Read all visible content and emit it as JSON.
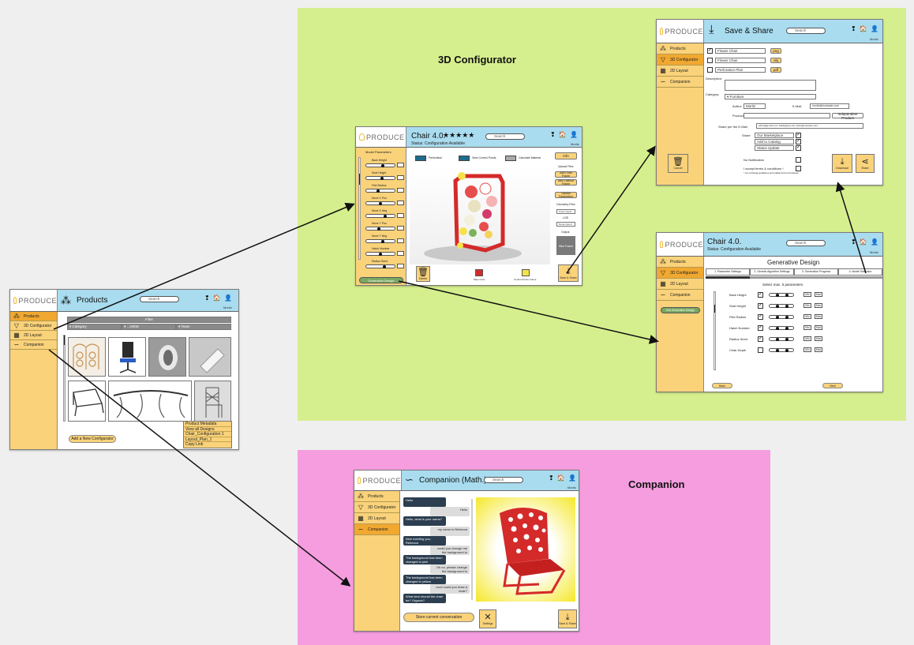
{
  "regions": {
    "configurator_label": "3D Configurator",
    "companion_label": "Companion"
  },
  "logo_text": "PRODUCE",
  "search_placeholder": "Search",
  "user_label": "Moritz",
  "header_icons": "❢ 🏠 👤",
  "sidebar": {
    "products": "Products",
    "configurator": "3D Configurator",
    "layout": "2D Layout",
    "companion": "Companion"
  },
  "products_screen": {
    "title": "Products",
    "filter_label": "Filter",
    "filter_cols": [
      "▾  Category",
      "▾  ...VIEW",
      "▾  Team"
    ],
    "context_menu": [
      "Product Metadata",
      "View all Designs",
      "Chair_Configuration 1",
      "Layout_Plan_1",
      "Copy Link"
    ],
    "add_button": "Add a New Configurator",
    "thumbnails": 8
  },
  "configurator_screen": {
    "title": "Chair 4.0.",
    "stars": "★★★★★",
    "subtitle": "Status: Configuration Available",
    "left_panel_title": "Model Parameters",
    "parameters": [
      "Back Height",
      "Seat Height",
      "Filet Radius",
      "Move X Pos",
      "Move X Neg",
      "Move Y Pos",
      "Move Y Neg",
      "Hatch Number",
      "Radius Seed"
    ],
    "toggles": [
      "Perforation",
      "View Control Points",
      "Calculate Material"
    ],
    "right_buttons": [
      "info",
      "Add Chair Frame",
      "Add Cushion Frame",
      "Upload Parameters"
    ],
    "right_labels": [
      "Upload Files",
      "Geometry Files",
      "LOD",
      "Output"
    ],
    "right_small": [
      "Front-Import",
      "None-Import"
    ],
    "right_box": "Wire Frame",
    "bottom_buttons": [
      "Delete",
      "Main Color",
      "Control Points Colors",
      "Save & Share"
    ],
    "generative_button": "Generative Design"
  },
  "save_screen": {
    "title": "Save & Share",
    "files": [
      {
        "name": "Flower Chair",
        "ext": "png"
      },
      {
        "name": "Flower Chair",
        "ext": "obj"
      },
      {
        "name": "Perforation Plan",
        "ext": "pdf"
      }
    ],
    "description_label": "Description:",
    "category_label": "Category:",
    "category_value": "▾  Furniture",
    "author_label": "Author",
    "author_value": "Moritz",
    "email_label": "E-Mail",
    "email_value": "moritz@example.com",
    "product_label": "Product",
    "independent_button": "Independent Product",
    "share_email_label": "Share per the E-Mail",
    "share_email_value": "adam@gmail.com; kaleb@gmx.de; karin@example.com; ...",
    "share_label": "Share",
    "share_options": [
      "Our Marketplace",
      "Add to Catalog",
      "Status Update"
    ],
    "no_notification": "No Notification",
    "accept_terms": "I accept terms & conditions *",
    "terms_note": "* our exchange guidelines and related terms of business",
    "cancel": "Cancel",
    "download": "Download",
    "share": "Share"
  },
  "generative_screen": {
    "title": "Chair 4.0.",
    "subtitle": "Status: Configuration Available",
    "heading": "Generative Design",
    "tabs": [
      "1. Parameter Settings",
      "2. Genetic Algorithm Settings",
      "3. Generation Progress",
      "4. Model Selection"
    ],
    "select_label": "Select max. 5 parameters",
    "params": [
      "Back Height",
      "Seat Height",
      "Filet Radius",
      "Hatch Number",
      "Radius Seed",
      "Chair Depth"
    ],
    "checked": [
      true,
      true,
      true,
      true,
      true,
      false
    ],
    "stepper_labels": [
      "Min",
      "Max"
    ],
    "back_button": "Back",
    "next_button": "Next",
    "side_button": "Exit Generative Design"
  },
  "companion_screen": {
    "title": "Companion (Math.)",
    "chat": [
      {
        "from": "left",
        "text": "Hello"
      },
      {
        "from": "right",
        "text": "Hello"
      },
      {
        "from": "left",
        "text": "Hello, what is your name?"
      },
      {
        "from": "right",
        "text": "my name is Rebecca"
      },
      {
        "from": "left",
        "text": "Nice meeting you, Rebecca"
      },
      {
        "from": "right",
        "text": "could you change me the background to green?"
      },
      {
        "from": "left",
        "text": "The background has been changed to pink"
      },
      {
        "from": "right",
        "text": "Oh no, please change the background to yellow"
      },
      {
        "from": "left",
        "text": "The background has been changed to yellow"
      },
      {
        "from": "right",
        "text": "cool! could you draw a chair?"
      },
      {
        "from": "left",
        "text": "What kind should the chair be? Organic?"
      }
    ],
    "store_button": "Store current conversation",
    "settings_button": "Settings",
    "save_button": "Save & Share"
  },
  "colors": {
    "header": "#a9dcef",
    "sidebar": "#f9d27a",
    "sidebar_active": "#f0a830",
    "configurator_bg": "#d6ef8e",
    "companion_bg": "#f59ddf",
    "chair_red": "#d42a2a"
  }
}
